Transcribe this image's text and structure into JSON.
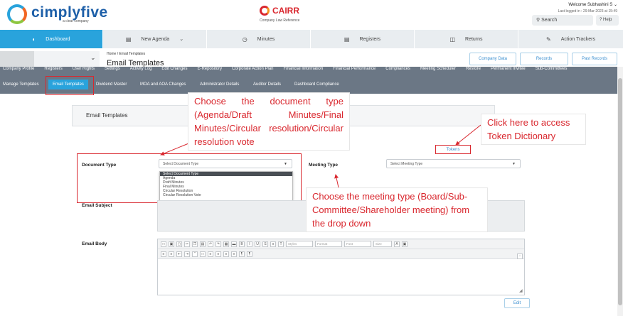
{
  "header": {
    "brand": "cimplyfive",
    "brand_sub": "a clear company",
    "center_brand": "CAIRR",
    "center_sub": "Company Law Reference",
    "welcome": "Welcome Subhashini  S",
    "last_logged": "Last logged in : 29-Mar-2023 at 15:49",
    "search_placeholder": "Search",
    "help": "Help"
  },
  "main_nav": [
    {
      "label": "Dashboard",
      "icon": "dashboard-icon"
    },
    {
      "label": "New Agenda",
      "icon": "agenda-icon"
    },
    {
      "label": "Minutes",
      "icon": "clock-icon"
    },
    {
      "label": "Registers",
      "icon": "register-icon"
    },
    {
      "label": "Returns",
      "icon": "returns-icon"
    },
    {
      "label": "Action Trackers",
      "icon": "tracker-icon"
    }
  ],
  "breadcrumb": {
    "path": "Home  /  Email Templates",
    "title": "Email Templates"
  },
  "top_buttons": [
    "Company Data",
    "Records",
    "Past Records"
  ],
  "sub_nav_1": [
    "Company Profile",
    "Registers",
    "User Rights",
    "Settings",
    "Activity Log",
    "Edit Changes",
    "E-Repository",
    "Corporate Action Plan",
    "Financial Information",
    "Financial Performance",
    "Compliances",
    "Meeting Scheduler",
    "Restore",
    "Permanent Invitee",
    "Sub-Committees"
  ],
  "sub_nav_2": [
    "Manage Templates",
    "Email Templates",
    "Dividend Master",
    "MOA and AOA Changes",
    "Administrator Details",
    "Auditor Details",
    "Dashboard Compliance"
  ],
  "panel_title": "Email Templates",
  "tokens_label": "Tokens",
  "form": {
    "document_type_label": "Document Type",
    "document_type_placeholder": "Select Document Type",
    "document_type_options": [
      "Select Document Type",
      "Agenda",
      "Draft Minutes",
      "Final Minutes",
      "Circular Resolution",
      "Circular Resolution Vote"
    ],
    "meeting_type_label": "Meeting Type",
    "meeting_type_placeholder": "Select Meeting Type",
    "email_subject_label": "Email Subject",
    "email_body_label": "Email Body",
    "editor_toolbar_selects": [
      "Styles",
      "Format",
      "Font",
      "Size"
    ],
    "edit_button": "Edit"
  },
  "callouts": {
    "document": "Choose the document type (Agenda/Draft Minutes/Final Minutes/Circular resolution/Circular resolution vote",
    "tokens": "Click here to access Token Dictionary",
    "meeting": "Choose the meeting type (Board/Sub-Committee/Shareholder meeting) from the drop down"
  },
  "colors": {
    "primary": "#29a3dc",
    "subnav": "#6b7785",
    "annotation": "#d9272e"
  }
}
